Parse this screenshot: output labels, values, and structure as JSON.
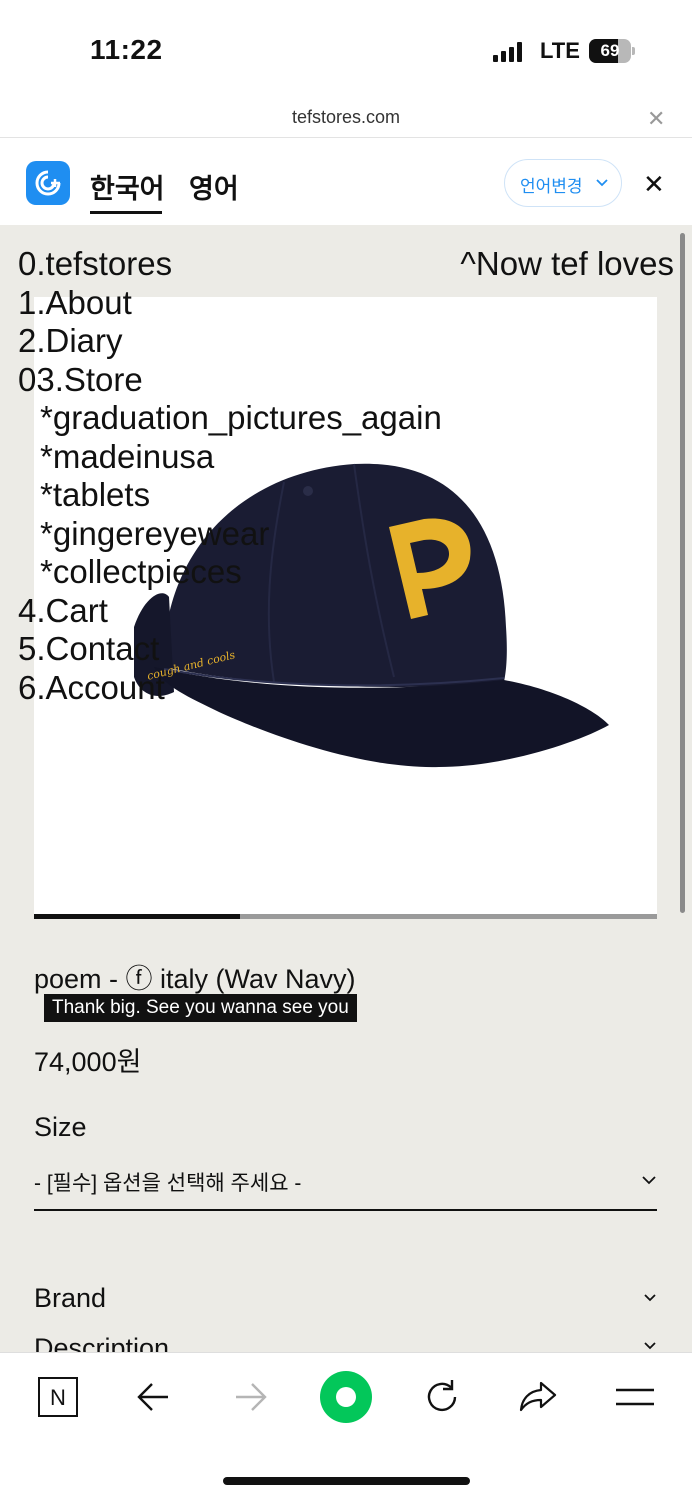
{
  "status_bar": {
    "time": "11:22",
    "network": "LTE",
    "battery": "69",
    "battery_level": 0.69
  },
  "browser": {
    "url": "tefstores.com"
  },
  "translate_bar": {
    "lang_source": "한국어",
    "lang_target": "영어",
    "change_label": "언어변경"
  },
  "site_nav": {
    "items": [
      "0.tefstores",
      "1.About",
      "2.Diary",
      "03.Store"
    ],
    "store_sub": [
      "*graduation_pictures_again",
      "*madeinusa",
      "*tablets",
      "*gingereyewear",
      "*collectpieces"
    ],
    "items_after": [
      "4.Cart",
      "5.Contact",
      "6.Account"
    ],
    "now_link": "^Now tef loves"
  },
  "product": {
    "name": "poem - ⓕ italy (Wav Navy)",
    "tagline": "Thank big. See you wanna see you",
    "price": "74,000원",
    "size_label": "Size",
    "size_placeholder": "- [필수] 옵션을 선택해 주세요 -",
    "brand_label": "Brand",
    "description_label": "Description",
    "cap_embroidery": "cough and cools",
    "cap_letter": "P",
    "carousel_progress": 0.33
  },
  "toolbar": {
    "naver_label": "N"
  },
  "colors": {
    "accent": "#1f8ef1",
    "naver_green": "#03c75a",
    "page_bg": "#ecebe6",
    "cap_navy": "#1a1c33",
    "cap_letter": "#e7b22b"
  }
}
